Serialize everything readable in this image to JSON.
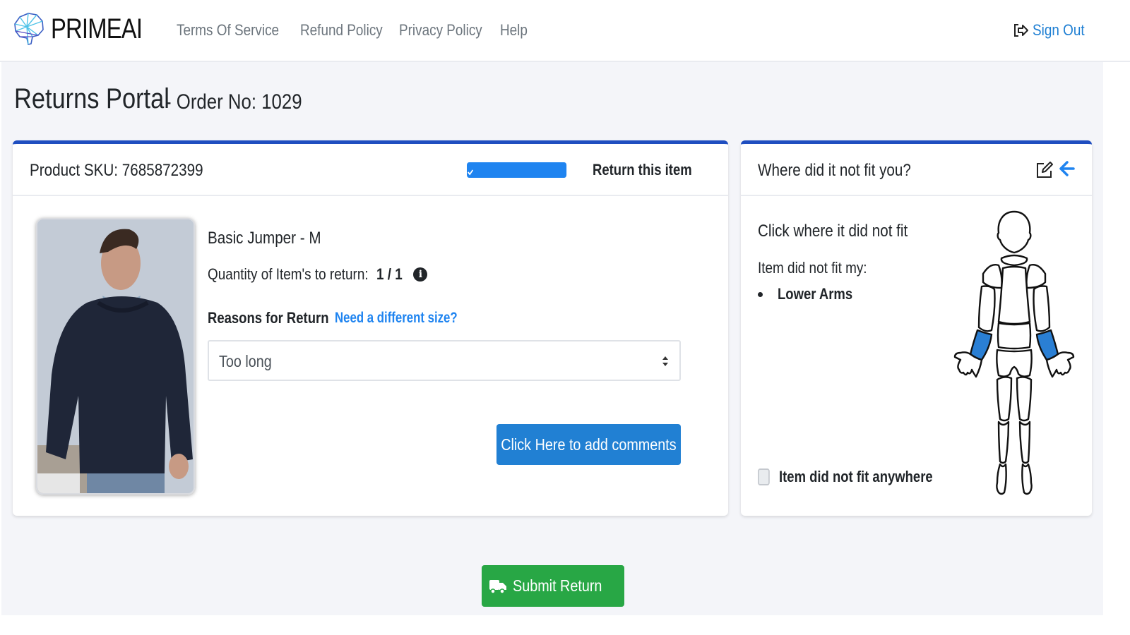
{
  "header": {
    "logo_text_light": "PRIME",
    "logo_text_bold": "AI",
    "nav": [
      {
        "label": "Terms Of Service"
      },
      {
        "label": "Refund Policy"
      },
      {
        "label": "Privacy Policy"
      },
      {
        "label": "Help"
      }
    ],
    "sign_out_label": "Sign Out"
  },
  "page": {
    "title": "Returns Portal",
    "order_label": "- Order No: 1029"
  },
  "product_card": {
    "sku_label": "Product SKU: 7685872399",
    "return_item_label": "Return this item",
    "return_item_checked": true,
    "product_name": "Basic Jumper - M",
    "quantity_label": "Quantity of Item's to return:",
    "quantity_value": "1 / 1",
    "reasons_label": "Reasons for Return",
    "different_size_link": "Need a different size?",
    "reason_selected": "Too long",
    "comments_button": "Click Here to add comments"
  },
  "fit_card": {
    "title": "Where did it not fit you?",
    "instruction": "Click where it did not fit",
    "not_fit_label": "Item did not fit my:",
    "selected_areas": [
      "Lower Arms"
    ],
    "anywhere_label": "Item did not fit anywhere",
    "anywhere_checked": false,
    "highlight_color": "#2a7fd4"
  },
  "footer": {
    "submit_label": "Submit Return"
  },
  "colors": {
    "accent_blue": "#2180d3",
    "card_top_border": "#1f4ec0",
    "submit_green": "#28a745",
    "link_blue": "#1f84f0"
  }
}
